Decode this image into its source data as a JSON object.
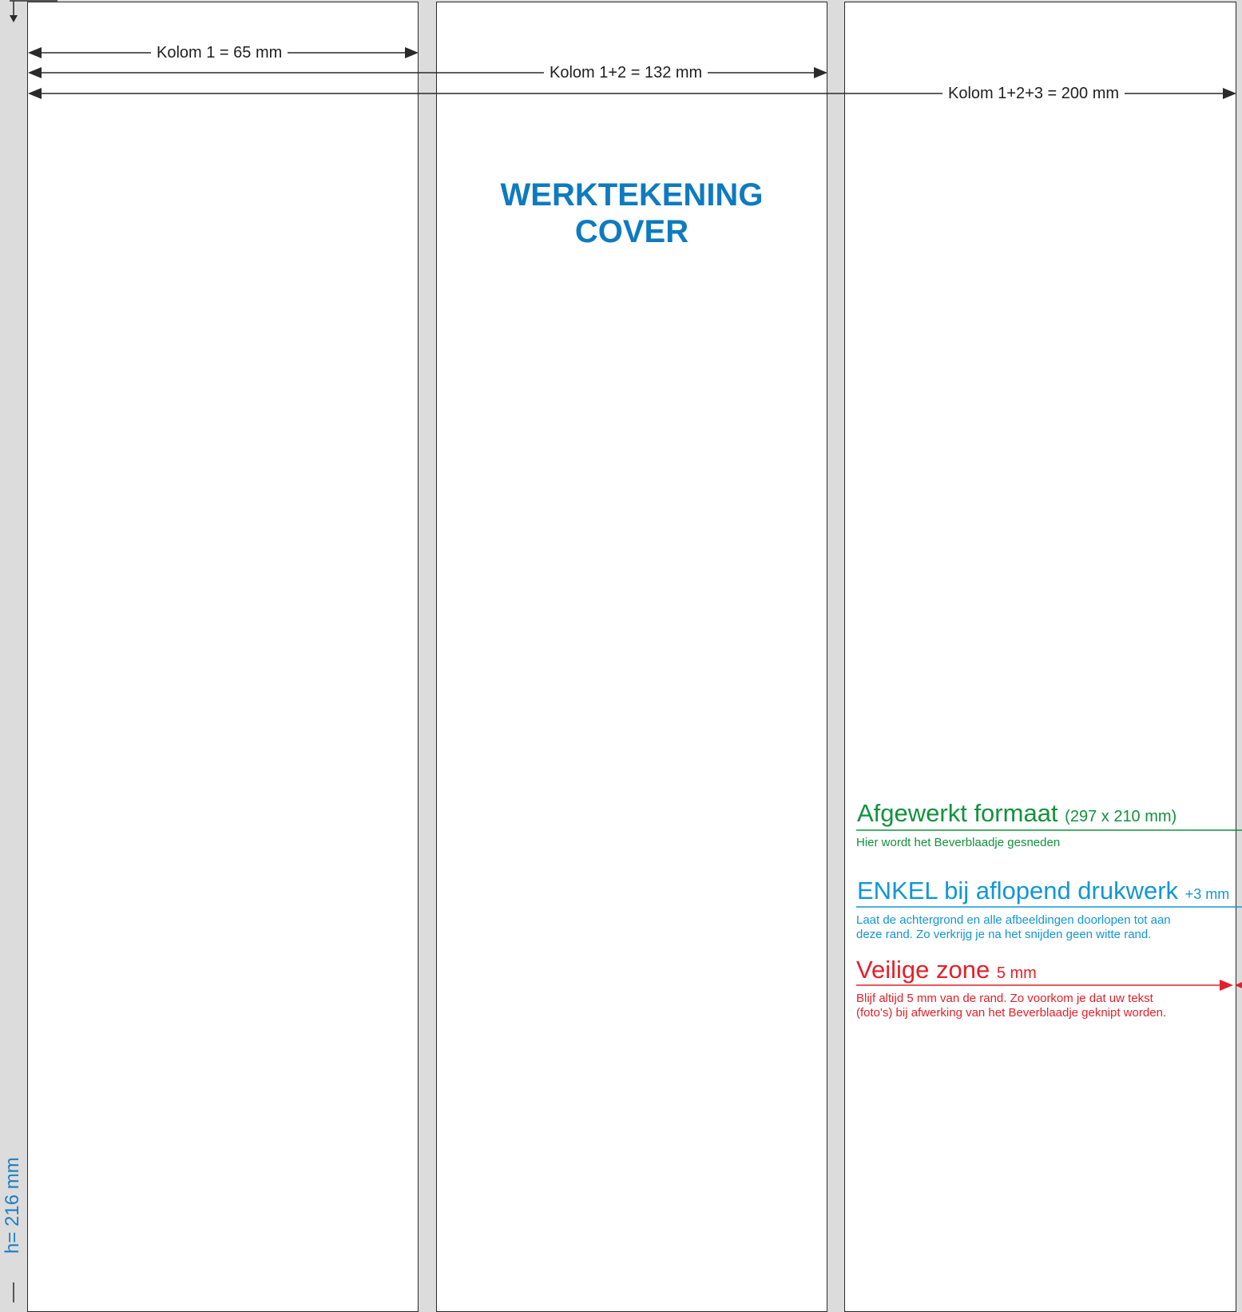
{
  "columns": {
    "kolom1": "Kolom 1 = 65 mm",
    "kolom12": "Kolom 1+2 = 132 mm",
    "kolom123": "Kolom 1+2+3 = 200 mm"
  },
  "title": {
    "line1": "WERKTEKENING",
    "line2": "COVER"
  },
  "legend": {
    "afgewerkt": {
      "title": "Afgewerkt formaat",
      "size": "(297 x 210 mm)",
      "desc": "Hier wordt het Beverblaadje gesneden",
      "color": "#12923e"
    },
    "enkel": {
      "title": "ENKEL bij aflopend drukwerk",
      "size": "+3 mm",
      "desc_line1": "Laat de achtergrond en alle afbeeldingen doorlopen tot aan",
      "desc_line2": "deze rand. Zo verkrijg je na het snijden geen witte rand.",
      "color": "#1296d6"
    },
    "veilig": {
      "title": "Veilige zone",
      "size": "5 mm",
      "desc_line1": "Blijf altijd 5 mm van de rand.  Zo voorkom je dat uw tekst",
      "desc_line2": "(foto's) bij afwerking van het Beverblaadje geknipt worden.",
      "color": "#e3202a"
    }
  },
  "height_label": "h= 216 mm",
  "colors": {
    "title": "#0f7ac0",
    "background": "#dcdcdc",
    "column": "#ffffff",
    "line": "#2a2a2a"
  }
}
